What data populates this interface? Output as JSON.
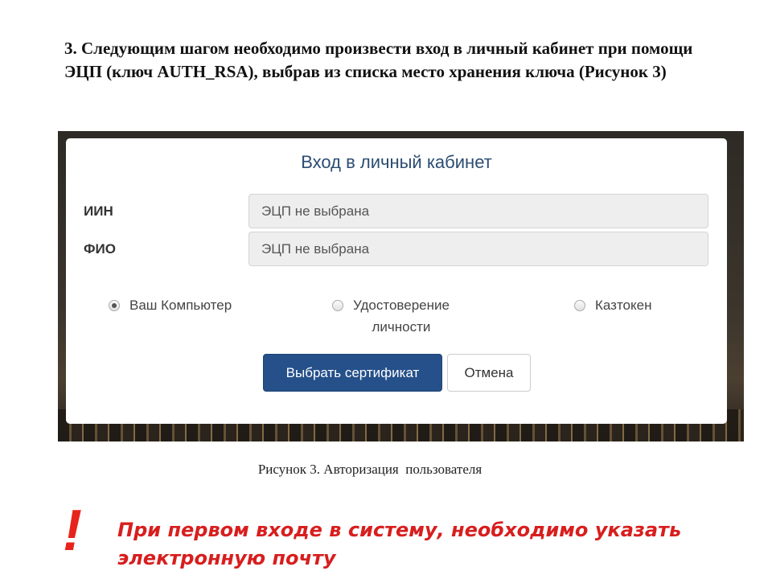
{
  "instruction": "3. Следующим шагом необходимо произвести вход в личный кабинет при помощи ЭЦП (ключ AUTH_RSA), выбрав из списка место хранения ключа (Рисунок 3)",
  "login_modal": {
    "title": "Вход в личный кабинет",
    "fields": [
      {
        "label": "ИИН",
        "placeholder": "ЭЦП не выбрана"
      },
      {
        "label": "ФИО",
        "placeholder": "ЭЦП не выбрана"
      }
    ],
    "storage_options": [
      {
        "label": "Ваш Компьютер",
        "checked": true
      },
      {
        "label_line1": "Удостоверение",
        "label_line2": "личности",
        "checked": false
      },
      {
        "label": "Казтокен",
        "checked": false
      }
    ],
    "select_certificate_label": "Выбрать сертификат",
    "cancel_label": "Отмена"
  },
  "caption": "Рисунок 3. Авторизация  пользователя",
  "warning": {
    "mark": "!",
    "line1": "При первом входе в систему, необходимо указать",
    "line2": "электронную почту"
  },
  "colors": {
    "accent_blue": "#25508a",
    "title_blue": "#2c4d73",
    "warning_red": "#d81e1e"
  }
}
